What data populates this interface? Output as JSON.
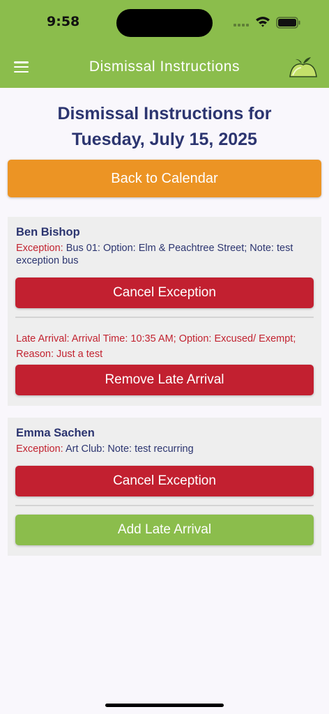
{
  "status_bar": {
    "time": "9:58"
  },
  "header": {
    "title": "Dismissal Instructions"
  },
  "page": {
    "heading_line1": "Dismissal Instructions for",
    "heading_line2": "Tuesday, July 15, 2025",
    "back_button": "Back to Calendar"
  },
  "students": [
    {
      "name": "Ben Bishop",
      "exception_label": "Exception:",
      "exception_text": " Bus 01: Option: Elm & Peachtree Street; Note: test exception bus",
      "cancel_button": "Cancel Exception",
      "late_arrival_text": "Late Arrival: Arrival Time: 10:35 AM; Option: Excused/ Exempt; Reason: Just a test",
      "remove_late_button": "Remove Late Arrival"
    },
    {
      "name": "Emma Sachen",
      "exception_label": "Exception:",
      "exception_text": " Art Club: Note: test recurring",
      "cancel_button": "Cancel Exception",
      "add_late_button": "Add Late Arrival"
    }
  ],
  "colors": {
    "brand_green": "#8bbd4c",
    "accent_orange": "#ec9424",
    "danger_red": "#c22030",
    "navy_text": "#2c3570"
  },
  "icons": [
    "signal-icon",
    "wifi-icon",
    "battery-icon",
    "hamburger-menu-icon",
    "apple-logo-icon"
  ]
}
